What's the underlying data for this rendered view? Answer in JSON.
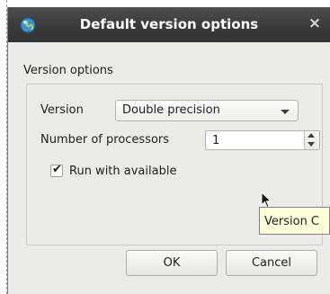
{
  "window": {
    "title": "Default version options",
    "close_symbol": "×",
    "icon": "app-globe-icon"
  },
  "group": {
    "title": "Version options",
    "version_label": "Version",
    "version_value": "Double precision",
    "processors_label": "Number of processors",
    "processors_value": "1",
    "run_available_label": "Run with available",
    "run_available_checked": true,
    "checkmark_symbol": "✔"
  },
  "buttons": {
    "ok": "OK",
    "cancel": "Cancel"
  },
  "tooltip": {
    "text": "Version C"
  },
  "colors": {
    "titlebar": "#3a3a3a",
    "dialog_bg": "#ebebe9",
    "tooltip_bg": "#ffffdc"
  }
}
